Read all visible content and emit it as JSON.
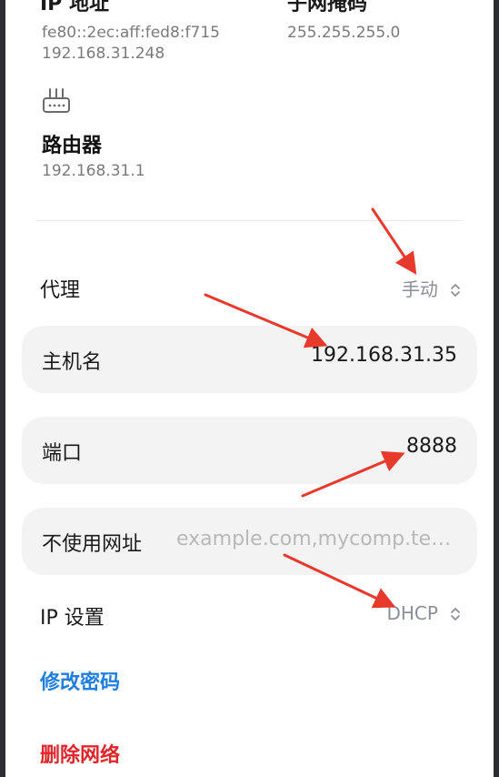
{
  "top": {
    "ip_label": "IP 地址",
    "ip_v6": "fe80::2ec:aff:fed8:f715",
    "ip_v4": "192.168.31.248",
    "subnet_label": "子网掩码",
    "subnet_value": "255.255.255.0"
  },
  "router": {
    "icon": "router-icon",
    "title": "路由器",
    "value": "192.168.31.1"
  },
  "proxy": {
    "label": "代理",
    "value": "手动"
  },
  "fields": {
    "hostname_label": "主机名",
    "hostname_value": "192.168.31.35",
    "port_label": "端口",
    "port_value": "8888",
    "bypass_label": "不使用网址",
    "bypass_placeholder": "example.com,mycomp.test.com"
  },
  "ip_settings": {
    "label": "IP 设置",
    "value": "DHCP"
  },
  "actions": {
    "change_password": "修改密码",
    "delete_network": "删除网络"
  },
  "colors": {
    "accent_blue": "#1f7fe0",
    "danger_red": "#e0262b",
    "annotation_red": "#e8392d",
    "field_bg": "#f3f3f3"
  }
}
